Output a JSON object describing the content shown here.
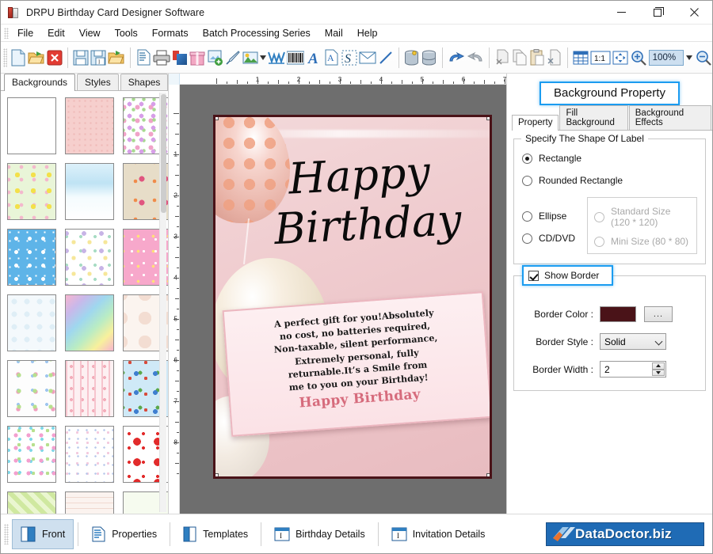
{
  "window": {
    "title": "DRPU Birthday Card Designer Software",
    "app_icon": "book-icon",
    "minimize": "minimize-icon",
    "maximize": "maximize-icon",
    "close": "close-icon"
  },
  "menubar": {
    "items": [
      {
        "label": "File"
      },
      {
        "label": "Edit"
      },
      {
        "label": "View"
      },
      {
        "label": "Tools"
      },
      {
        "label": "Formats"
      },
      {
        "label": "Batch Processing Series"
      },
      {
        "label": "Mail"
      },
      {
        "label": "Help"
      }
    ]
  },
  "toolbar": {
    "groups": [
      {
        "buttons": [
          {
            "name": "new-document-icon"
          },
          {
            "name": "open-folder-icon"
          },
          {
            "name": "close-document-icon"
          }
        ]
      },
      {
        "buttons": [
          {
            "name": "save-icon"
          },
          {
            "name": "save-as-icon"
          },
          {
            "name": "export-icon"
          }
        ]
      },
      {
        "buttons": [
          {
            "name": "print-preview-icon"
          },
          {
            "name": "print-icon"
          },
          {
            "name": "card-layers-icon"
          },
          {
            "name": "gift-box-icon"
          },
          {
            "name": "add-image-icon"
          },
          {
            "name": "pen-icon"
          },
          {
            "name": "picture-shape-icon"
          },
          {
            "name": "watermark-icon"
          },
          {
            "name": "barcode-icon"
          },
          {
            "name": "text-icon"
          },
          {
            "name": "text-document-icon"
          },
          {
            "name": "signature-icon"
          },
          {
            "name": "envelope-icon"
          },
          {
            "name": "line-tool-icon"
          }
        ]
      },
      {
        "buttons": [
          {
            "name": "database-icon"
          },
          {
            "name": "database-list-icon"
          }
        ]
      },
      {
        "buttons": [
          {
            "name": "undo-icon"
          },
          {
            "name": "redo-icon"
          }
        ]
      },
      {
        "buttons": [
          {
            "name": "cut-icon"
          },
          {
            "name": "copy-icon"
          },
          {
            "name": "paste-icon"
          },
          {
            "name": "delete-icon"
          }
        ]
      },
      {
        "buttons": [
          {
            "name": "grid-icon"
          },
          {
            "name": "actual-size-icon"
          },
          {
            "name": "fit-page-icon"
          },
          {
            "name": "zoom-in-icon"
          }
        ]
      }
    ],
    "actual_size_label": "1:1",
    "zoom_value": "100%",
    "zoom_dropdown_icon": "chevron-down-icon",
    "zoom_out_icon": "zoom-out-icon"
  },
  "left_panel": {
    "tabs": [
      {
        "label": "Backgrounds",
        "active": true
      },
      {
        "label": "Styles",
        "active": false
      },
      {
        "label": "Shapes",
        "active": false
      }
    ],
    "thumbnails": [
      {
        "name": "sky-clouds"
      },
      {
        "name": "pink-texture"
      },
      {
        "name": "flowers-white"
      },
      {
        "name": "yellow-daisies"
      },
      {
        "name": "winter-scene"
      },
      {
        "name": "bird-balloons"
      },
      {
        "name": "blue-stars"
      },
      {
        "name": "pastel-balloons"
      },
      {
        "name": "pink-party"
      },
      {
        "name": "bubbles"
      },
      {
        "name": "rainbow-gradient"
      },
      {
        "name": "teddy-bear"
      },
      {
        "name": "happy-birthday-banner"
      },
      {
        "name": "pink-hearts-stripes"
      },
      {
        "name": "colorful-balloons"
      },
      {
        "name": "pastel-hearts"
      },
      {
        "name": "balloon-bouquets"
      },
      {
        "name": "red-hearts"
      },
      {
        "name": "green-stripes"
      },
      {
        "name": "cake-pattern"
      },
      {
        "name": "green-meadow"
      }
    ]
  },
  "canvas": {
    "h_ruler_numbers": [
      "1",
      "2",
      "3",
      "4",
      "5",
      "6",
      "7"
    ],
    "v_ruler_numbers": [
      "1",
      "2",
      "3",
      "4",
      "5",
      "6",
      "7",
      "8"
    ],
    "card": {
      "heading_line1": "Happy",
      "heading_line2": "Birthday",
      "note_lines": [
        "A perfect gift for you!Absolutely",
        "no cost, no batteries required,",
        "Non-taxable, silent performance,",
        "Extremely personal, fully",
        "returnable.It’s a Smile from",
        "me to you on your Birthday!"
      ],
      "note_signature": "Happy Birthday"
    }
  },
  "right_panel": {
    "title": "Background Property",
    "tabs": [
      {
        "label": "Property",
        "active": true
      },
      {
        "label": "Fill Background",
        "active": false
      },
      {
        "label": "Background Effects",
        "active": false
      }
    ],
    "shape_group": {
      "legend": "Specify The Shape Of Label",
      "options": [
        {
          "label": "Rectangle",
          "selected": true,
          "enabled": true
        },
        {
          "label": "Rounded Rectangle",
          "selected": false,
          "enabled": true
        },
        {
          "label": "Ellipse",
          "selected": false,
          "enabled": true
        },
        {
          "label": "CD/DVD",
          "selected": false,
          "enabled": true
        }
      ],
      "cd_options": [
        {
          "label": "Standard Size (120 * 120)",
          "selected": false,
          "enabled": false
        },
        {
          "label": "Mini Size (80 * 80)",
          "selected": false,
          "enabled": false
        }
      ]
    },
    "border_group": {
      "show_border_label": "Show Border",
      "show_border_checked": true,
      "color_label": "Border Color :",
      "color_value": "#4a1318",
      "color_browse_label": "...",
      "style_label": "Border Style :",
      "style_value": "Solid",
      "width_label": "Border Width :",
      "width_value": "2"
    }
  },
  "statusbar": {
    "buttons": [
      {
        "label": "Front",
        "icon": "card-front-icon",
        "active": true
      },
      {
        "label": "Properties",
        "icon": "properties-icon",
        "active": false
      },
      {
        "label": "Templates",
        "icon": "templates-icon",
        "active": false
      },
      {
        "label": "Birthday Details",
        "icon": "birthday-details-icon",
        "active": false
      },
      {
        "label": "Invitation Details",
        "icon": "invitation-details-icon",
        "active": false
      }
    ],
    "brand": "DataDoctor.biz"
  },
  "colors": {
    "accent_blue": "#1b9cf0",
    "border_maroon": "#4a1318",
    "brand_blue": "#1f6bb5",
    "stage_gray": "#6e6e6e"
  }
}
